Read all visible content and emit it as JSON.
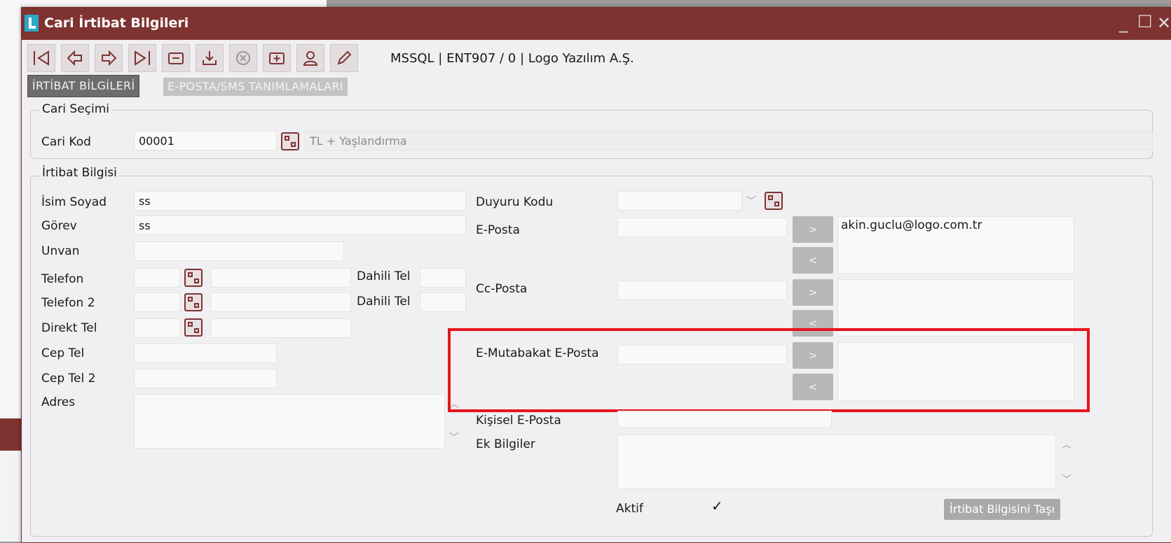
{
  "window": {
    "title": "Cari İrtibat Bilgileri",
    "minimize": "_",
    "maximize": "☐",
    "close": "✕"
  },
  "toolbar": {
    "info": "MSSQL | ENT907 / 0 | Logo Yazılım A.Ş.",
    "icons": [
      "first-record-icon",
      "previous-record-icon",
      "next-record-icon",
      "last-record-icon",
      "filter-icon",
      "import-icon",
      "cancel-icon",
      "add-icon",
      "user-icon",
      "edit-icon"
    ]
  },
  "tabs": {
    "irtibat": "İRTİBAT BİLGİLERİ",
    "eposta": "E-POSTA/SMS TANIMLAMALARI"
  },
  "cari_secimi": {
    "legend": "Cari Seçimi",
    "kod_label": "Cari Kod",
    "kod_value": "00001",
    "desc": "TL + Yaşlandırma"
  },
  "irtibat": {
    "legend": "İrtibat Bilgisi",
    "isim_label": "İsim Soyad",
    "isim_value": "ss",
    "gorev_label": "Görev",
    "gorev_value": "ss",
    "unvan_label": "Unvan",
    "telefon_label": "Telefon",
    "telefon2_label": "Telefon 2",
    "dahili_label": "Dahili Tel",
    "direkt_label": "Direkt Tel",
    "cep_label": "Cep Tel",
    "cep2_label": "Cep Tel 2",
    "adres_label": "Adres",
    "duyuru_label": "Duyuru Kodu",
    "eposta_label": "E-Posta",
    "eposta_list": [
      "akin.guclu@logo.com.tr"
    ],
    "cc_label": "Cc-Posta",
    "emut_label": "E-Mutabakat E-Posta",
    "kisisel_label": "Kişisel E-Posta",
    "ek_label": "Ek Bilgiler",
    "aktif_label": "Aktif",
    "aktif_mark": "✓",
    "add_btn": ">",
    "remove_btn": "<",
    "tasi_btn": "İrtibat Bilgisini Taşı"
  }
}
